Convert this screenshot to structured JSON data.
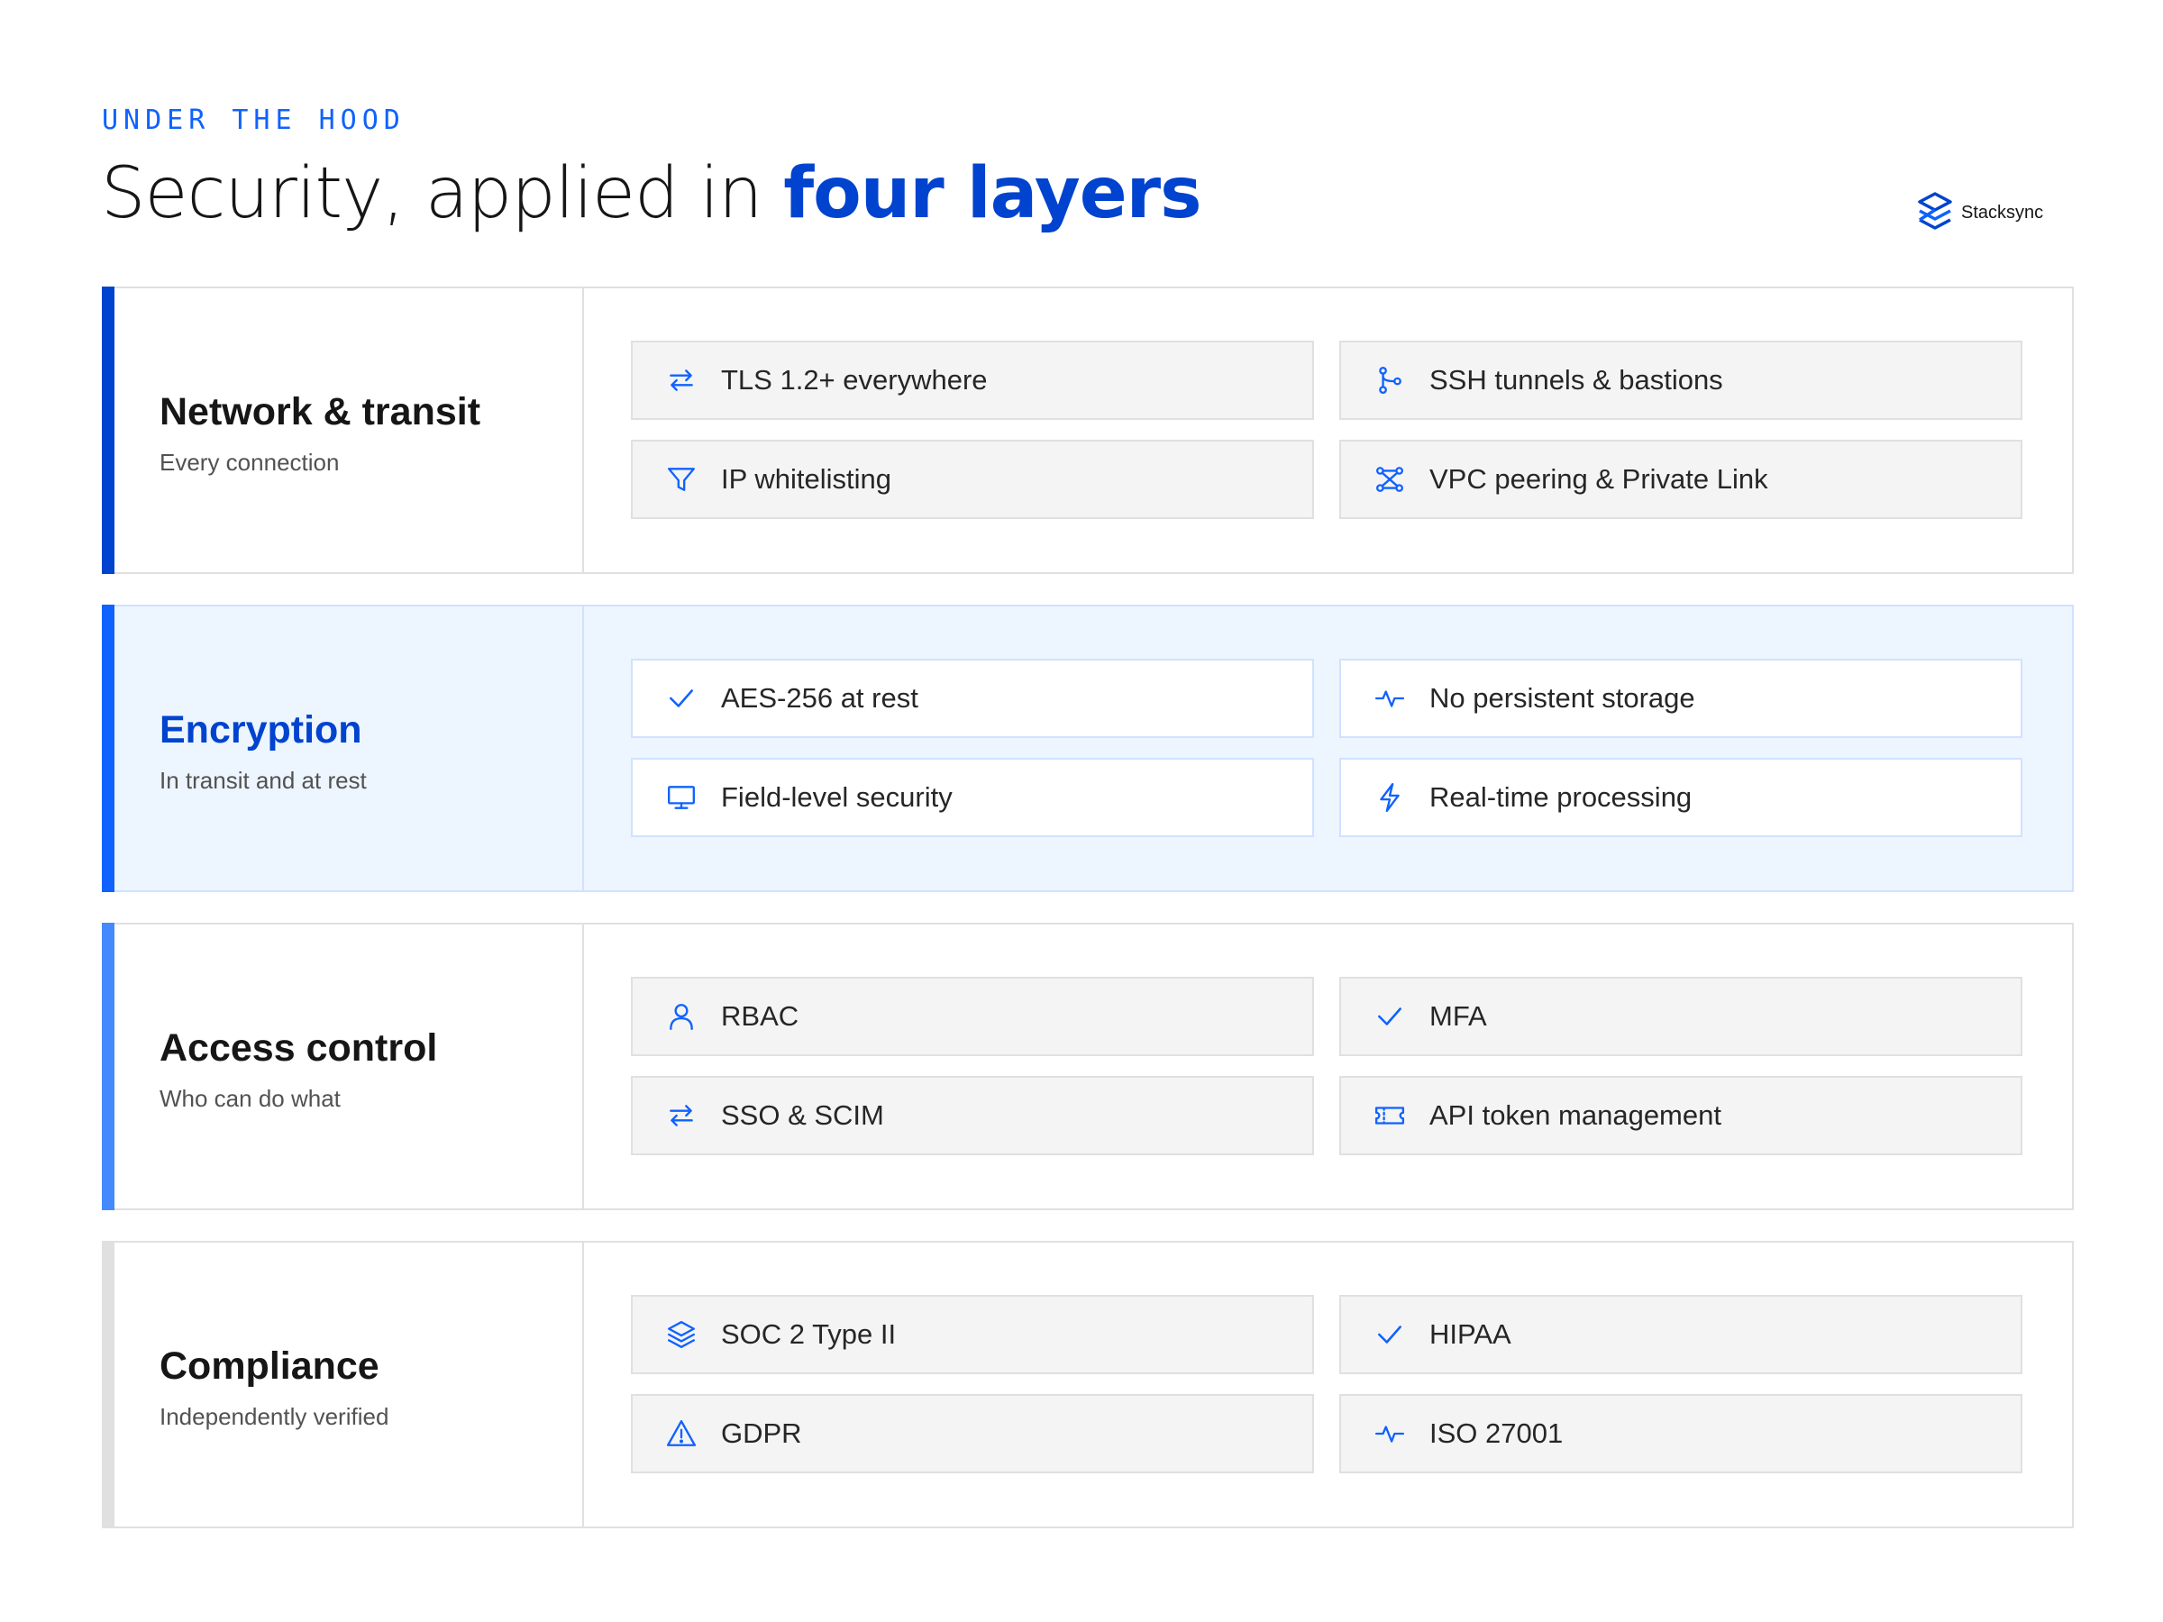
{
  "header": {
    "eyebrow": "UNDER THE HOOD",
    "title_prefix": "Security, applied in ",
    "title_highlight": "four layers"
  },
  "brand": {
    "name": "Stacksync",
    "logo_icon": "stacksync-logo-icon"
  },
  "colors": {
    "primary": "#0f62fe",
    "primary_dark": "#0043ce",
    "layer_accents": [
      "#0043ce",
      "#0f62fe",
      "#4589ff",
      "#e0e0e0"
    ],
    "highlight_bg": "#edf5ff"
  },
  "layers": [
    {
      "title": "Network & transit",
      "subtitle": "Every connection",
      "highlighted": false,
      "items": [
        {
          "label": "TLS 1.2+ everywhere",
          "icon": "arrows-horizontal-icon"
        },
        {
          "label": "SSH tunnels & bastions",
          "icon": "branch-icon"
        },
        {
          "label": "IP whitelisting",
          "icon": "filter-icon"
        },
        {
          "label": "VPC peering & Private Link",
          "icon": "network-icon"
        }
      ]
    },
    {
      "title": "Encryption",
      "subtitle": "In transit and at rest",
      "highlighted": true,
      "items": [
        {
          "label": "AES-256 at rest",
          "icon": "checkmark-icon"
        },
        {
          "label": "No persistent storage",
          "icon": "activity-icon"
        },
        {
          "label": "Field-level security",
          "icon": "monitor-icon"
        },
        {
          "label": "Real-time processing",
          "icon": "lightning-icon"
        }
      ]
    },
    {
      "title": "Access control",
      "subtitle": "Who can do what",
      "highlighted": false,
      "items": [
        {
          "label": "RBAC",
          "icon": "user-icon"
        },
        {
          "label": "MFA",
          "icon": "checkmark-icon"
        },
        {
          "label": "SSO & SCIM",
          "icon": "arrows-horizontal-icon"
        },
        {
          "label": "API token management",
          "icon": "ticket-icon"
        }
      ]
    },
    {
      "title": "Compliance",
      "subtitle": "Independently verified",
      "highlighted": false,
      "items": [
        {
          "label": "SOC 2 Type II",
          "icon": "layers-icon"
        },
        {
          "label": "HIPAA",
          "icon": "checkmark-icon"
        },
        {
          "label": "GDPR",
          "icon": "warning-triangle-icon"
        },
        {
          "label": "ISO 27001",
          "icon": "activity-icon"
        }
      ]
    }
  ]
}
